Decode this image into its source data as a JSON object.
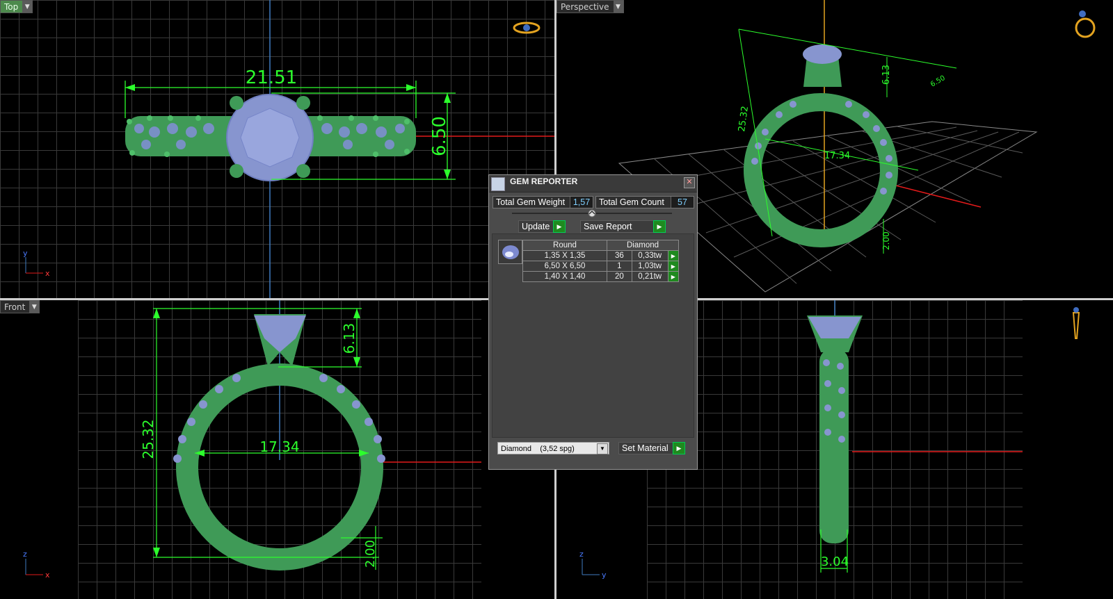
{
  "viewports": {
    "top": {
      "label": "Top",
      "axis_v": "y",
      "axis_h": "x",
      "dims": {
        "width": "21.51",
        "height": "6.50"
      }
    },
    "perspective": {
      "label": "Perspective",
      "dims": {
        "height": "25.32",
        "head": "6.13",
        "stone": "6.50",
        "inner": "17.34",
        "shank": "2.00"
      }
    },
    "front": {
      "label": "Front",
      "axis_v": "z",
      "axis_h": "x",
      "dims": {
        "height": "25.32",
        "head": "6.13",
        "inner": "17.34",
        "shank": "2.00"
      }
    },
    "right": {
      "axis_v": "z",
      "axis_h": "y",
      "dims": {
        "width": "3.04"
      }
    }
  },
  "gem_reporter": {
    "title": "GEM REPORTER",
    "total_weight_label": "Total Gem Weight",
    "total_weight_value": "1,57",
    "total_count_label": "Total Gem Count",
    "total_count_value": "57",
    "update_label": "Update",
    "save_report_label": "Save Report",
    "table": {
      "header_shape": "Round",
      "header_material": "Diamond",
      "rows": [
        {
          "size": "1,35 X 1,35",
          "count": "36",
          "weight": "0,33tw"
        },
        {
          "size": "6,50 X 6,50",
          "count": "1",
          "weight": "1,03tw"
        },
        {
          "size": "1,40 X 1,40",
          "count": "20",
          "weight": "0,21tw"
        }
      ]
    },
    "material_value": "Diamond    (3,52 spg)",
    "set_material_label": "Set Material"
  },
  "colors": {
    "ring": "#3f9a57",
    "gem": "#8795cf",
    "dimension": "#2cff2c",
    "x_axis": "#e21a1a",
    "y_axis": "#3f7cc0"
  }
}
